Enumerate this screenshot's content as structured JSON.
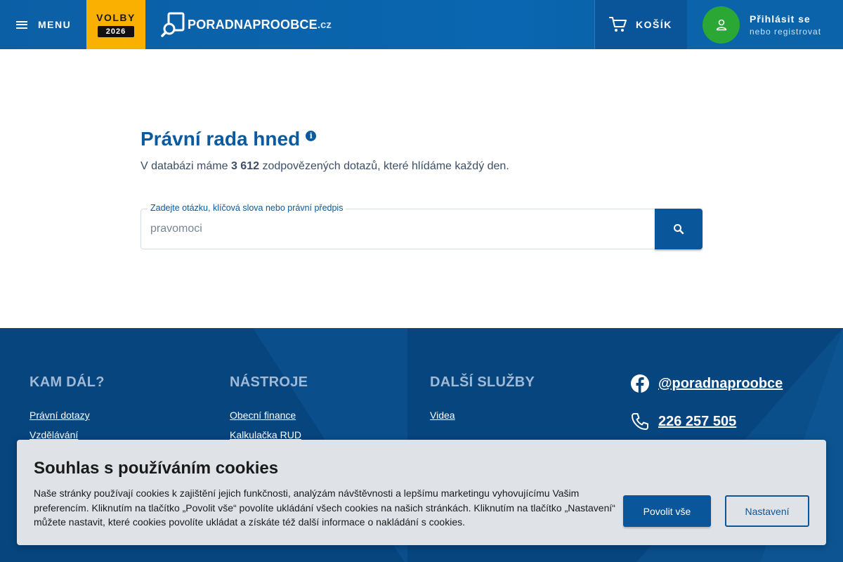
{
  "header": {
    "menu_label": "MENU",
    "volby_label": "VOLBY",
    "volby_year": "2026",
    "logo_brand": "PORADNAPROOBCE",
    "logo_tld": ".cz",
    "cart_label": "KOŠÍK",
    "login_label": "Přihlásit se",
    "register_label": "nebo registrovat",
    "colors": {
      "header_blue": "#0b5fa5",
      "volby_yellow": "#f9b000",
      "avatar_green": "#2aa735"
    }
  },
  "main": {
    "title": "Právní rada hned",
    "subtitle_pre": "V databázi máme ",
    "subtitle_count": "3 612",
    "subtitle_post": " zodpovězených dotazů, které hlídáme každý den.",
    "search_label": "Zadejte otázku, klíčová slova nebo právní předpis",
    "search_value": "pravomoci"
  },
  "footer": {
    "columns": [
      {
        "title": "KAM DÁL?",
        "links": [
          "Právní dotazy",
          "Vzdělávání"
        ]
      },
      {
        "title": "NÁSTROJE",
        "links": [
          "Obecní finance",
          "Kalkulačka RUD"
        ]
      },
      {
        "title": "DALŠÍ SLUŽBY",
        "links": [
          "Videa"
        ]
      }
    ],
    "facebook_handle": "@poradnaproobce",
    "phone": "226 257 505"
  },
  "cookie": {
    "title": "Souhlas s používáním cookies",
    "text": "Naše stránky používají cookies k zajištění jejich funkčnosti, analýzám návštěvnosti a lepšímu marketingu vyhovujícímu Vašim preferencím. Kliknutím na tlačítko „Povolit vše“ povolíte ukládání všech cookies na našich stránkách. Kliknutím na tlačítko „Nastavení“ můžete nastavit, které cookies povolíte ukládat a získáte též další informace o nakládání s cookies.",
    "allow_label": "Povolit vše",
    "settings_label": "Nastavení"
  }
}
